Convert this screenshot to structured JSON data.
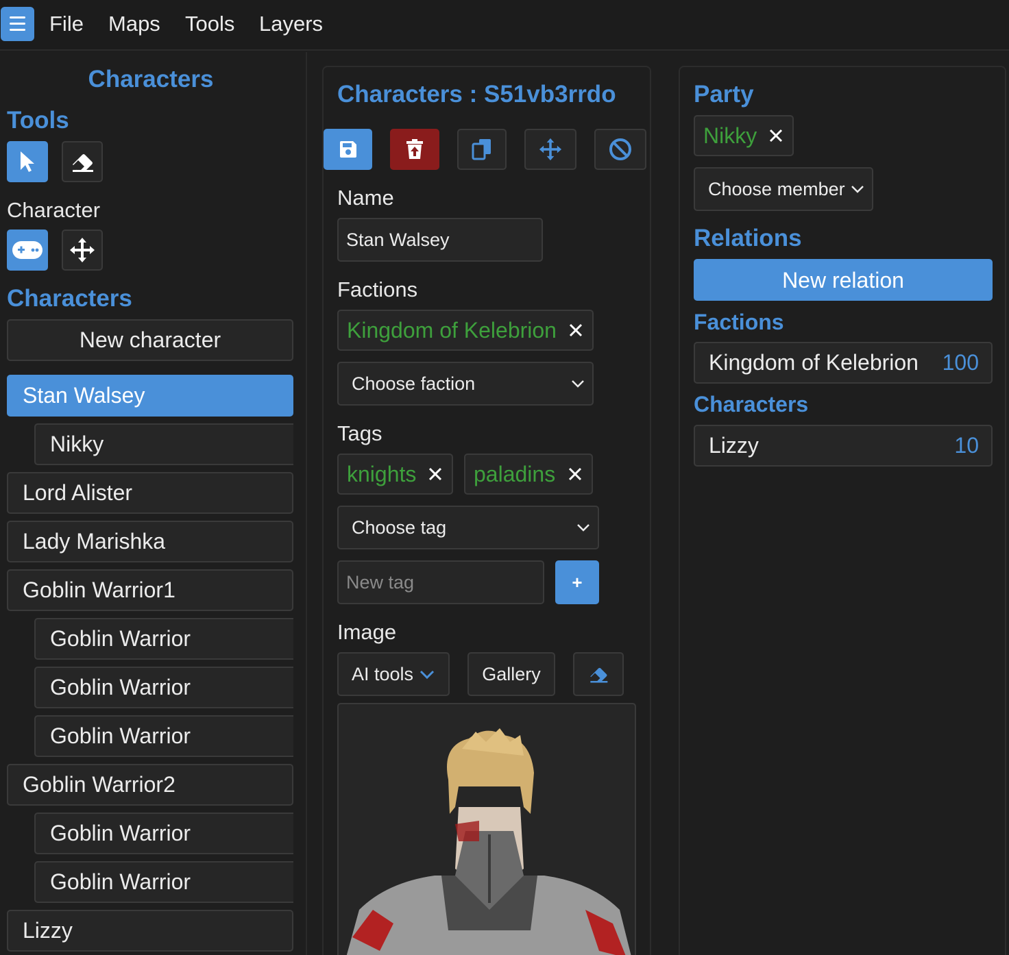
{
  "menu": {
    "items": [
      "File",
      "Maps",
      "Tools",
      "Layers"
    ]
  },
  "sidebar": {
    "title": "Characters",
    "tools_heading": "Tools",
    "character_heading": "Character",
    "characters_heading": "Characters",
    "new_character_label": "New character",
    "list": [
      "Stan Walsey",
      "Nikky",
      "Lord Alister",
      "Lady Marishka",
      "Goblin Warrior1",
      "Goblin Warrior",
      "Goblin Warrior",
      "Goblin Warrior",
      "Goblin Warrior2",
      "Goblin Warrior",
      "Goblin Warrior",
      "Lizzy"
    ]
  },
  "editor": {
    "title": "Characters : S51vb3rrdo",
    "name_label": "Name",
    "name_value": "Stan Walsey",
    "factions_label": "Factions",
    "faction_chip": "Kingdom of Kelebrion",
    "faction_select": "Choose faction",
    "tags_label": "Tags",
    "tags": [
      "knights",
      "paladins"
    ],
    "tag_select": "Choose tag",
    "new_tag_placeholder": "New tag",
    "add_tag_label": "+",
    "image_label": "Image",
    "ai_tools_label": "AI tools",
    "gallery_label": "Gallery"
  },
  "relations_panel": {
    "party_heading": "Party",
    "party_member": "Nikky",
    "member_select": "Choose member",
    "relations_heading": "Relations",
    "new_relation_label": "New relation",
    "factions_heading": "Factions",
    "faction_relations": [
      {
        "name": "Kingdom of Kelebrion",
        "value": "100"
      }
    ],
    "characters_heading": "Characters",
    "character_relations": [
      {
        "name": "Lizzy",
        "value": "10"
      }
    ]
  },
  "colors": {
    "accent": "#4a90d9",
    "danger": "#8a1c1c",
    "tag": "#3ea03c",
    "background": "#1e1e1e"
  }
}
